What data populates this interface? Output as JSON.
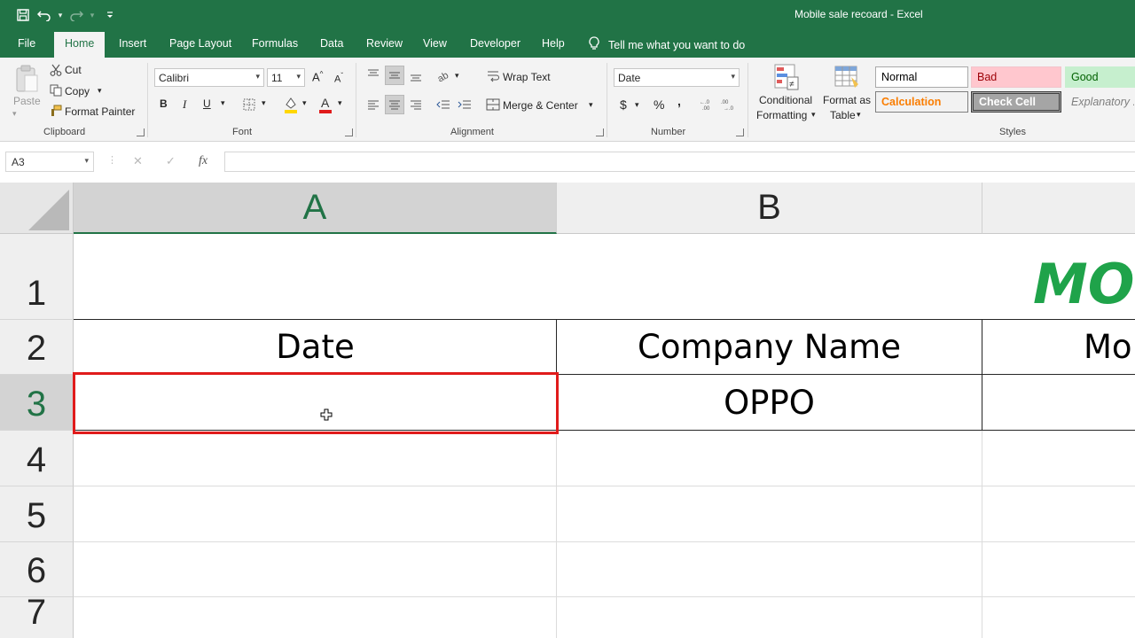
{
  "window": {
    "title": "Mobile sale recoard  -  Excel"
  },
  "qat": {
    "save_icon": "save-icon",
    "undo_icon": "undo-icon",
    "redo_icon": "redo-icon"
  },
  "tabs": [
    "File",
    "Home",
    "Insert",
    "Page Layout",
    "Formulas",
    "Data",
    "Review",
    "View",
    "Developer",
    "Help"
  ],
  "tell_me": "Tell me what you want to do",
  "clipboard": {
    "paste": "Paste",
    "cut": "Cut",
    "copy": "Copy",
    "format_painter": "Format Painter",
    "label": "Clipboard"
  },
  "font": {
    "name": "Calibri",
    "size": "11",
    "bold": "B",
    "italic": "I",
    "underline": "U",
    "label": "Font",
    "fill_color": "#ffd700",
    "font_color": "#e01b1b"
  },
  "alignment": {
    "wrap_text": "Wrap Text",
    "merge_center": "Merge & Center",
    "label": "Alignment"
  },
  "number": {
    "format": "Date",
    "currency": "$",
    "percent": "%",
    "comma": ",",
    "label": "Number"
  },
  "styles": {
    "conditional_formatting": [
      "Conditional",
      "Formatting"
    ],
    "format_as_table": [
      "Format as",
      "Table"
    ],
    "normal": "Normal",
    "bad": "Bad",
    "good": "Good",
    "calculation": "Calculation",
    "check_cell": "Check Cell",
    "explanatory": "Explanatory ...",
    "label": "Styles"
  },
  "formula_bar": {
    "name_box": "A3",
    "fx": "fx",
    "value": ""
  },
  "columns": [
    "A",
    "B"
  ],
  "rows": [
    "1",
    "2",
    "3",
    "4",
    "5",
    "6",
    "7"
  ],
  "cells": {
    "title_partial": "MO",
    "A2": "Date",
    "B2": "Company Name",
    "C2_partial": "Mo",
    "A3": "",
    "B3": "OPPO"
  },
  "colors": {
    "excel_green": "#217346",
    "title_green": "#1fa34a",
    "selection_red": "#e01b1b"
  }
}
